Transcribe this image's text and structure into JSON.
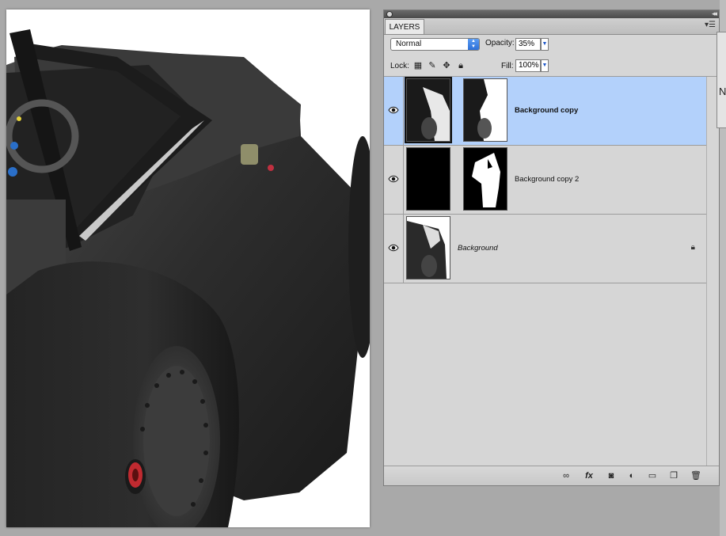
{
  "panel": {
    "tab": "LAYERS",
    "blend_mode": "Normal",
    "opacity_label": "Opacity:",
    "opacity_value": "35%",
    "lock_label": "Lock:",
    "fill_label": "Fill:",
    "fill_value": "100%",
    "layers": [
      {
        "name": "Background copy",
        "visible": true,
        "selected": true,
        "bold": true
      },
      {
        "name": "Background copy 2",
        "visible": true,
        "selected": false,
        "bold": false
      },
      {
        "name": "Background",
        "visible": true,
        "selected": false,
        "italic": true,
        "locked": true
      }
    ]
  },
  "dock": {
    "letter": "N"
  },
  "colors": {
    "selection": "#b3d1fb",
    "panel_bg": "#d6d6d6",
    "app_bg": "#a9a9a9"
  }
}
